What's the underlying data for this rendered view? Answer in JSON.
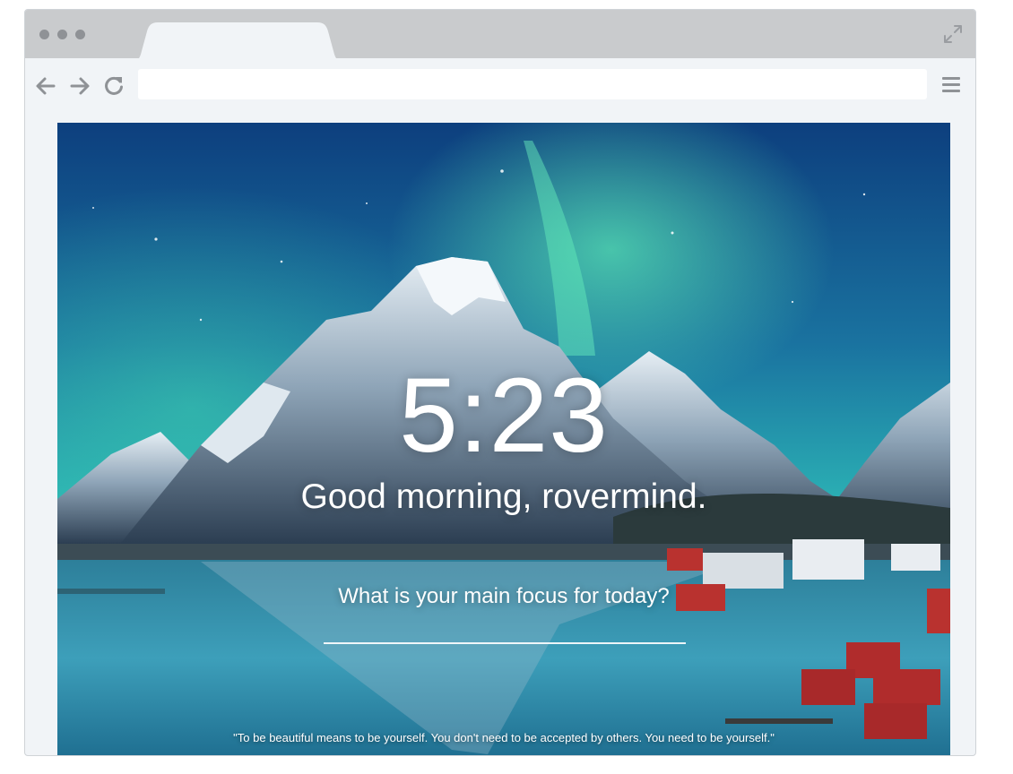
{
  "browser": {
    "url": "",
    "colors": {
      "chrome": "#f1f4f7",
      "titlebar": "#c9cbcd",
      "icons": "#8f9296"
    }
  },
  "dashboard": {
    "time": "5:23",
    "greeting": "Good morning, rovermind.",
    "focus_prompt": "What is your main focus for today?",
    "focus_value": "",
    "quote": "\"To be beautiful means to be yourself. You don't need to be accepted by others. You need to be yourself.\""
  },
  "icons": {
    "back": "arrow-left-icon",
    "forward": "arrow-right-icon",
    "reload": "reload-icon",
    "menu": "hamburger-menu-icon",
    "expand": "expand-icon"
  }
}
